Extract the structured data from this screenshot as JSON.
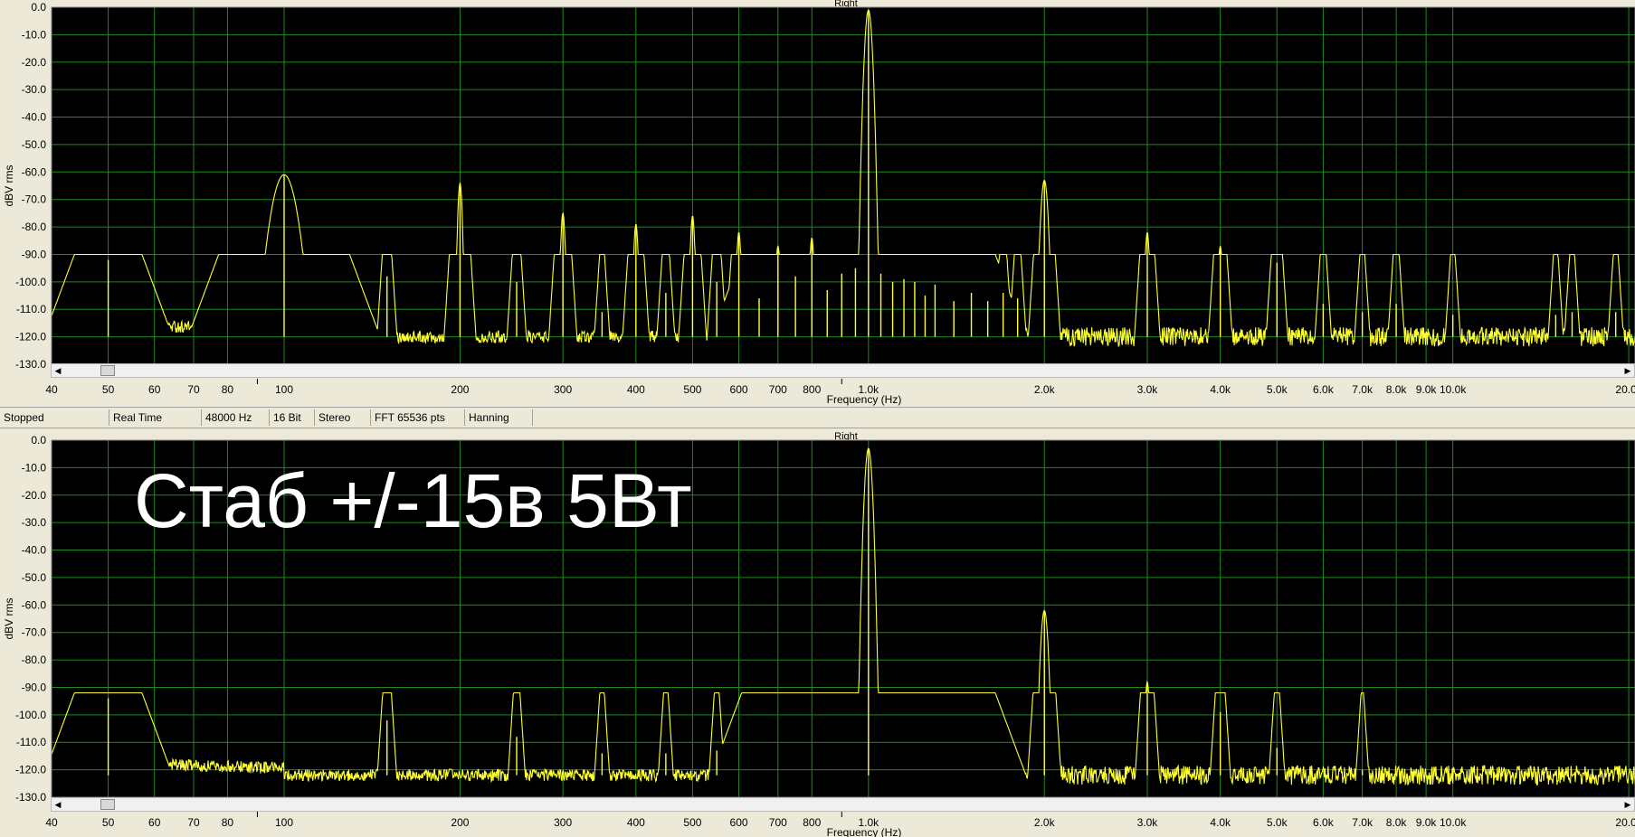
{
  "statusbar": {
    "state": "Stopped",
    "mode": "Real Time",
    "sample_rate": "48000 Hz",
    "bits": "16 Bit",
    "channels": "Stereo",
    "fft": "FFT 65536 pts",
    "window": "Hanning"
  },
  "caption": "Стаб +/-15в 5Вт",
  "colors": {
    "plot_bg": "#000000",
    "grid": "#1f8a1f",
    "trace": "#ffff33",
    "frame_bg": "#ece9d8"
  },
  "chart_data": [
    {
      "type": "line",
      "title": "Right",
      "xlabel": "Frequency (Hz)",
      "ylabel": "dBV rms",
      "xscale": "log",
      "xlim": [
        40,
        20500
      ],
      "ylim": [
        -130,
        0
      ],
      "x_ticks": [
        "40",
        "50",
        "60",
        "70",
        "80",
        "100",
        "200",
        "300",
        "400",
        "500",
        "600",
        "700",
        "800",
        "1.0k",
        "2.0k",
        "3.0k",
        "4.0k",
        "5.0k",
        "6.0k",
        "7.0k",
        "8.0k",
        "9.0k",
        "10.0k",
        "20.0k"
      ],
      "y_ticks": [
        "0.0",
        "-10.0",
        "-20.0",
        "-30.0",
        "-40.0",
        "-50.0",
        "-60.0",
        "-70.0",
        "-80.0",
        "-90.0",
        "-100.0",
        "-110.0",
        "-120.0",
        "-130.0"
      ],
      "grid": true,
      "noise_floor_db": -120,
      "series": [
        {
          "peaks": [
            {
              "x": 50,
              "y": -92
            },
            {
              "x": 100,
              "y": -61
            },
            {
              "x": 150,
              "y": -98
            },
            {
              "x": 200,
              "y": -64
            },
            {
              "x": 250,
              "y": -100
            },
            {
              "x": 300,
              "y": -75
            },
            {
              "x": 350,
              "y": -111
            },
            {
              "x": 400,
              "y": -79
            },
            {
              "x": 450,
              "y": -104
            },
            {
              "x": 500,
              "y": -76
            },
            {
              "x": 550,
              "y": -100
            },
            {
              "x": 600,
              "y": -82
            },
            {
              "x": 650,
              "y": -106
            },
            {
              "x": 700,
              "y": -87
            },
            {
              "x": 750,
              "y": -98
            },
            {
              "x": 800,
              "y": -84
            },
            {
              "x": 850,
              "y": -103
            },
            {
              "x": 900,
              "y": -97
            },
            {
              "x": 950,
              "y": -95
            },
            {
              "x": 1000,
              "y": -1
            },
            {
              "x": 1050,
              "y": -97
            },
            {
              "x": 1100,
              "y": -100
            },
            {
              "x": 1150,
              "y": -99
            },
            {
              "x": 1200,
              "y": -100
            },
            {
              "x": 1250,
              "y": -105
            },
            {
              "x": 1300,
              "y": -101
            },
            {
              "x": 1400,
              "y": -107
            },
            {
              "x": 1500,
              "y": -104
            },
            {
              "x": 1600,
              "y": -107
            },
            {
              "x": 1700,
              "y": -104
            },
            {
              "x": 1800,
              "y": -106
            },
            {
              "x": 2000,
              "y": -63
            },
            {
              "x": 3000,
              "y": -82
            },
            {
              "x": 4000,
              "y": -87
            },
            {
              "x": 5000,
              "y": -93
            },
            {
              "x": 6000,
              "y": -108
            },
            {
              "x": 7000,
              "y": -111
            },
            {
              "x": 8000,
              "y": -108
            },
            {
              "x": 10000,
              "y": -112
            },
            {
              "x": 15000,
              "y": -112
            },
            {
              "x": 16000,
              "y": -111
            },
            {
              "x": 19000,
              "y": -111
            }
          ]
        }
      ]
    },
    {
      "type": "line",
      "title": "Right",
      "xlabel": "Frequency (Hz)",
      "ylabel": "dBV rms",
      "xscale": "log",
      "xlim": [
        40,
        20500
      ],
      "ylim": [
        -130,
        0
      ],
      "x_ticks": [
        "40",
        "50",
        "60",
        "70",
        "80",
        "100",
        "200",
        "300",
        "400",
        "500",
        "600",
        "700",
        "800",
        "1.0k",
        "2.0k",
        "3.0k",
        "4.0k",
        "5.0k",
        "6.0k",
        "7.0k",
        "8.0k",
        "9.0k",
        "10.0k",
        "20.0k"
      ],
      "y_ticks": [
        "0.0",
        "-10.0",
        "-20.0",
        "-30.0",
        "-40.0",
        "-50.0",
        "-60.0",
        "-70.0",
        "-80.0",
        "-90.0",
        "-100.0",
        "-110.0",
        "-120.0",
        "-130.0"
      ],
      "grid": true,
      "noise_floor_db": -122,
      "series": [
        {
          "peaks": [
            {
              "x": 50,
              "y": -94
            },
            {
              "x": 150,
              "y": -102
            },
            {
              "x": 250,
              "y": -108
            },
            {
              "x": 350,
              "y": -114
            },
            {
              "x": 450,
              "y": -114
            },
            {
              "x": 550,
              "y": -113
            },
            {
              "x": 1000,
              "y": -3
            },
            {
              "x": 2000,
              "y": -62
            },
            {
              "x": 3000,
              "y": -88
            },
            {
              "x": 4000,
              "y": -99
            },
            {
              "x": 5000,
              "y": -112
            },
            {
              "x": 7000,
              "y": -120
            }
          ]
        }
      ]
    }
  ]
}
